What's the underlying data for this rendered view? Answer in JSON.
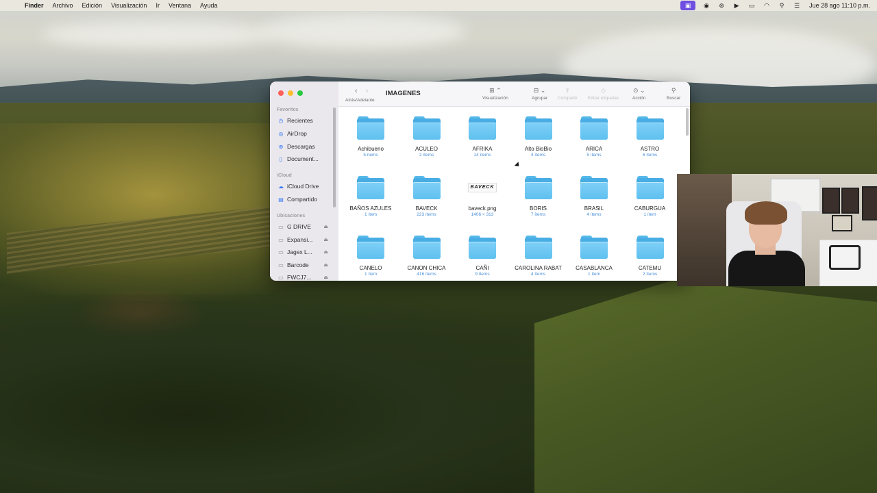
{
  "menubar": {
    "app_name": "Finder",
    "menus": [
      "Archivo",
      "Edición",
      "Visualización",
      "Ir",
      "Ventana",
      "Ayuda"
    ],
    "status_icons": [
      "screen-record-icon",
      "app-c-icon",
      "app-badge-icon",
      "play-icon",
      "battery-icon",
      "wifi-icon",
      "spotlight-search-icon",
      "control-center-icon"
    ],
    "clock": "Jue 28 ago  11:10 p.m."
  },
  "finder": {
    "title": "IMAGENES",
    "toolbar": {
      "nav_label": "Atrás/Adelante",
      "view_label": "Visualización",
      "group_label": "Agrupar",
      "share_label": "Compartir",
      "tags_label": "Editar etiquetas",
      "action_label": "Acción",
      "search_label": "Buscar"
    },
    "sidebar": {
      "favorites_title": "Favoritos",
      "favorites": [
        {
          "label": "Recientes",
          "icon": "clock-icon"
        },
        {
          "label": "AirDrop",
          "icon": "airdrop-icon"
        },
        {
          "label": "Descargas",
          "icon": "downloads-icon"
        },
        {
          "label": "Document...",
          "icon": "document-icon"
        }
      ],
      "icloud_title": "iCloud",
      "icloud": [
        {
          "label": "iCloud Drive",
          "icon": "cloud-icon"
        },
        {
          "label": "Compartido",
          "icon": "shared-folder-icon"
        }
      ],
      "locations_title": "Ubicaciones",
      "locations": [
        {
          "label": "G DRIVE",
          "icon": "drive-icon"
        },
        {
          "label": "Expansi...",
          "icon": "drive-icon"
        },
        {
          "label": "Jagex L...",
          "icon": "drive-icon"
        },
        {
          "label": "Barcode",
          "icon": "drive-icon"
        },
        {
          "label": "FWCJ7...",
          "icon": "drive-icon"
        }
      ]
    },
    "items": [
      {
        "name": "Achibueno",
        "meta": "5 ítems",
        "kind": "folder"
      },
      {
        "name": "ACULEO",
        "meta": "2 ítems",
        "kind": "folder"
      },
      {
        "name": "AFRIKA",
        "meta": "14 ítems",
        "kind": "folder"
      },
      {
        "name": "Alto BioBio",
        "meta": "4 ítems",
        "kind": "folder"
      },
      {
        "name": "ARICA",
        "meta": "5 ítems",
        "kind": "folder"
      },
      {
        "name": "ASTRO",
        "meta": "6 ítems",
        "kind": "folder"
      },
      {
        "name": "BAÑOS AZULES",
        "meta": "1 ítem",
        "kind": "folder"
      },
      {
        "name": "BAVECK",
        "meta": "223 ítems",
        "kind": "folder"
      },
      {
        "name": "baveck.png",
        "meta": "1406 × 313",
        "kind": "image",
        "thumb_text": "BAVECK"
      },
      {
        "name": "BORIS",
        "meta": "7 ítems",
        "kind": "folder"
      },
      {
        "name": "BRASIL",
        "meta": "4 ítems",
        "kind": "folder"
      },
      {
        "name": "CABURGUA",
        "meta": "1 ítem",
        "kind": "folder"
      },
      {
        "name": "CANELO",
        "meta": "1 ítem",
        "kind": "folder"
      },
      {
        "name": "CANON CHICA",
        "meta": "416 ítems",
        "kind": "folder"
      },
      {
        "name": "CAÑI",
        "meta": "9 ítems",
        "kind": "folder"
      },
      {
        "name": "CAROLINA RABAT",
        "meta": "4 ítems",
        "kind": "folder"
      },
      {
        "name": "CASABLANCA",
        "meta": "1 ítem",
        "kind": "folder"
      },
      {
        "name": "CATEMU",
        "meta": "2 ítems",
        "kind": "folder"
      }
    ]
  },
  "colors": {
    "accent": "#3478f6",
    "folder": "#5fc0ef",
    "meta_text": "#4a8fd8"
  }
}
